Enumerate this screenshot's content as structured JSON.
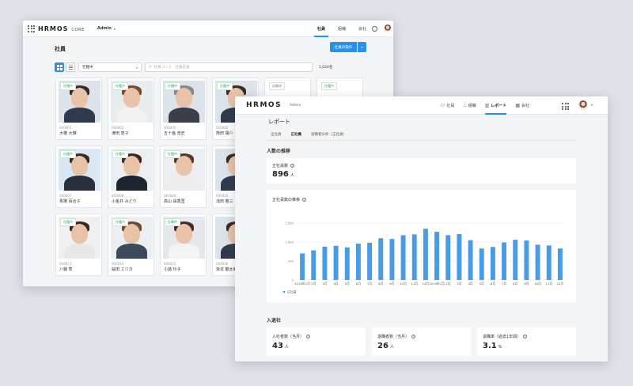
{
  "employees_window": {
    "logo": "HRMOS",
    "logo_suffix": "CORE",
    "role_selector": "Admin",
    "nav": [
      {
        "label": "社員",
        "active": true
      },
      {
        "label": "組織",
        "active": false
      },
      {
        "label": "会社",
        "active": false
      }
    ],
    "page_title": "社員",
    "action_button": "社員の操作",
    "status_filter": "在籍中",
    "search_placeholder": "社員コード、社員名等",
    "count": "1,024名",
    "employees": [
      {
        "status": "在籍中",
        "id": "000001",
        "name": "大橋 大輝"
      },
      {
        "status": "在籍中",
        "id": "000002",
        "name": "津田 恵子"
      },
      {
        "status": "在籍中",
        "id": "000005",
        "name": "五十嵐 浩史"
      },
      {
        "status": "在籍中",
        "id": "000006",
        "name": "熊田 陽介"
      },
      {
        "status": "在籍中",
        "id": "000007",
        "name": "馬場 百合子"
      },
      {
        "status": "在籍中",
        "id": "000008",
        "name": "小金井 みどり"
      },
      {
        "status": "在籍中",
        "id": "000009",
        "name": "高山 由香里"
      },
      {
        "status": "在籍中",
        "id": "000010",
        "name": "浅田 敬三"
      },
      {
        "status": "在籍中",
        "id": "000013",
        "name": "八幡 隼"
      },
      {
        "status": "在籍中",
        "id": "000014",
        "name": "桜田 エリカ"
      },
      {
        "status": "在籍中",
        "id": "000015",
        "name": "小諸 玲子"
      },
      {
        "status": "在籍中",
        "id": "000016",
        "name": "坂本 龍太郎"
      }
    ],
    "partial_tags": [
      "退職済",
      "在籍中"
    ]
  },
  "report_window": {
    "logo": "HRMOS",
    "role_label": "Admin",
    "nav": [
      {
        "label": "社員",
        "icon": "people-icon",
        "active": false
      },
      {
        "label": "組織",
        "icon": "org-icon",
        "active": false
      },
      {
        "label": "レポート",
        "icon": "chart-icon",
        "active": true
      },
      {
        "label": "会社",
        "icon": "building-icon",
        "active": false
      }
    ],
    "page_title": "レポート",
    "tabs": [
      {
        "label": "全社員",
        "active": false
      },
      {
        "label": "正社員",
        "active": true
      },
      {
        "label": "退職者分析（正社員）",
        "active": false
      }
    ],
    "headcount_section": "人数の推移",
    "regular_count_label": "正社員数",
    "regular_count_value": "896",
    "unit_person": "人",
    "trend_label": "正社員数の推移",
    "join_section": "入退社",
    "stats": [
      {
        "label": "入社者数（当月）",
        "value": "43",
        "unit": "人"
      },
      {
        "label": "退職者数（当月）",
        "value": "26",
        "unit": "人"
      },
      {
        "label": "退職率（過去1年間）",
        "value": "3.1",
        "unit": "%"
      }
    ]
  },
  "chart_data": {
    "type": "bar",
    "categories": [
      "2018年1月",
      "2月",
      "3月",
      "4月",
      "5月",
      "6月",
      "7月",
      "8月",
      "9月",
      "10月",
      "11月",
      "12月",
      "2019年1月",
      "2月",
      "3月",
      "4月",
      "5月",
      "6月",
      "7月",
      "8月",
      "9月",
      "10月",
      "11月",
      "12月"
    ],
    "series": [
      {
        "name": "正社員",
        "values": [
          700,
          780,
          880,
          900,
          860,
          960,
          980,
          1100,
          1080,
          1180,
          1200,
          1350,
          1270,
          1180,
          1210,
          1050,
          830,
          870,
          990,
          1060,
          1040,
          930,
          910,
          830
        ]
      }
    ],
    "y_ticks": [
      "1,500",
      "1,000",
      "500",
      "0"
    ],
    "ylim": [
      0,
      1500
    ],
    "color": "#4a9be6",
    "legend_position": "bottom-left",
    "grid": true
  }
}
